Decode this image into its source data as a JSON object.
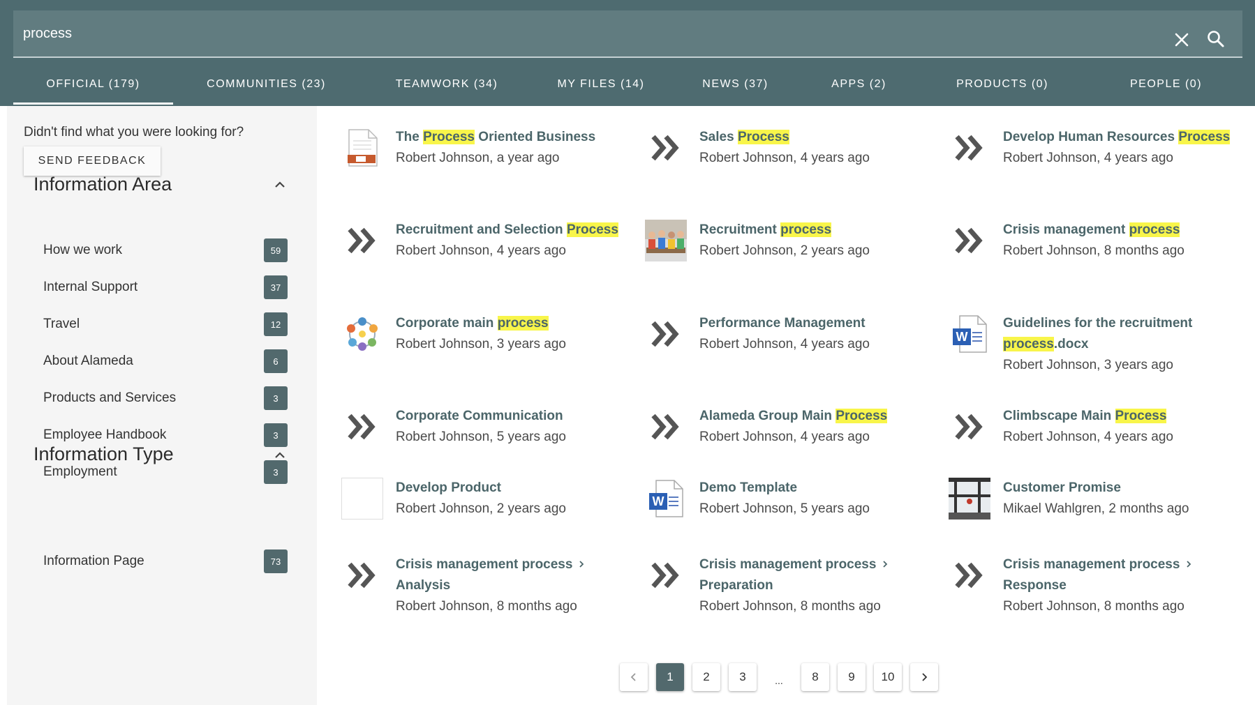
{
  "search": {
    "value": "process"
  },
  "tabs": [
    {
      "label": "OFFICIAL (179)",
      "active": true
    },
    {
      "label": "COMMUNITIES (23)",
      "active": false
    },
    {
      "label": "TEAMWORK (34)",
      "active": false
    },
    {
      "label": "MY FILES (14)",
      "active": false
    },
    {
      "label": "NEWS (37)",
      "active": false
    },
    {
      "label": "APPS (2)",
      "active": false
    },
    {
      "label": "PRODUCTS (0)",
      "active": false
    },
    {
      "label": "PEOPLE (0)",
      "active": false
    }
  ],
  "sidebar": {
    "feedback_text": "Didn't find what you were looking for?",
    "feedback_button": "SEND FEEDBACK",
    "information_area": {
      "title": "Information Area",
      "items": [
        {
          "label": "How we work",
          "count": "59"
        },
        {
          "label": "Internal Support",
          "count": "37"
        },
        {
          "label": "Travel",
          "count": "12"
        },
        {
          "label": "About Alameda",
          "count": "6"
        },
        {
          "label": "Products and Services",
          "count": "3"
        },
        {
          "label": "Employee Handbook",
          "count": "3"
        },
        {
          "label": "Employment",
          "count": "3"
        }
      ]
    },
    "information_type": {
      "title": "Information Type",
      "items": [
        {
          "label": "Information Page",
          "count": "73"
        }
      ]
    }
  },
  "results": [
    {
      "title": [
        "The ",
        "Process",
        " Oriented Business"
      ],
      "meta": "Robert Johnson, a year ago",
      "icon": "document-icon"
    },
    {
      "title": [
        "",
        "Sales ",
        "Process"
      ],
      "meta": "Robert Johnson, 4 years ago",
      "icon": "double-chevron-icon"
    },
    {
      "title": [
        "Develop Human Resources ",
        "Process",
        ""
      ],
      "meta": "Robert Johnson, 4 years ago",
      "icon": "double-chevron-icon"
    },
    {
      "title": [
        "Recruitment and Selection ",
        "Process",
        ""
      ],
      "meta": "Robert Johnson, 4 years ago",
      "icon": "double-chevron-icon"
    },
    {
      "title": [
        "Recruitment ",
        "process",
        ""
      ],
      "meta": "Robert Johnson, 2 years ago",
      "icon": "people-photo-icon"
    },
    {
      "title": [
        "Crisis management ",
        "process",
        ""
      ],
      "meta": "Robert Johnson, 8 months ago",
      "icon": "double-chevron-icon"
    },
    {
      "title": [
        "Corporate main ",
        "process",
        ""
      ],
      "meta": "Robert Johnson, 3 years ago",
      "icon": "process-diagram-icon"
    },
    {
      "title": [
        "Performance Management",
        "",
        ""
      ],
      "meta": "Robert Johnson, 4 years ago",
      "icon": "double-chevron-icon"
    },
    {
      "title": [
        "Guidelines for the recruitment ",
        "process",
        ".docx"
      ],
      "meta": "Robert Johnson, 3 years ago",
      "icon": "word-document-icon"
    },
    {
      "title": [
        "Corporate Communication",
        "",
        ""
      ],
      "meta": "Robert Johnson, 5 years ago",
      "icon": "double-chevron-icon"
    },
    {
      "title": [
        "Alameda Group Main ",
        "Process",
        ""
      ],
      "meta": "Robert Johnson, 4 years ago",
      "icon": "double-chevron-icon"
    },
    {
      "title": [
        "Climbscape Main ",
        "Process",
        ""
      ],
      "meta": "Robert Johnson, 4 years ago",
      "icon": "double-chevron-icon"
    },
    {
      "title": [
        "Develop Product",
        "",
        ""
      ],
      "meta": "Robert Johnson, 2 years ago",
      "icon": "blank-image-icon"
    },
    {
      "title": [
        "Demo Template",
        "",
        ""
      ],
      "meta": "Robert Johnson, 5 years ago",
      "icon": "word-document-icon"
    },
    {
      "title": [
        "Customer Promise",
        "",
        ""
      ],
      "meta": "Mikael Wahlgren, 2 months ago",
      "icon": "window-photo-icon"
    },
    {
      "crumb": "Crisis management process",
      "title": [
        "Analysis",
        "",
        ""
      ],
      "meta": "Robert Johnson, 8 months ago",
      "icon": "double-chevron-icon"
    },
    {
      "crumb": "Crisis management process",
      "title": [
        "Preparation",
        "",
        ""
      ],
      "meta": "Robert Johnson, 8 months ago",
      "icon": "double-chevron-icon"
    },
    {
      "crumb": "Crisis management process",
      "title": [
        "Response",
        "",
        ""
      ],
      "meta": "Robert Johnson, 8 months ago",
      "icon": "double-chevron-icon"
    }
  ],
  "pagination": {
    "pages": [
      "1",
      "2",
      "3",
      "...",
      "8",
      "9",
      "10"
    ],
    "current": "1"
  },
  "colors": {
    "header": "#4e6b70",
    "accent": "#52696d",
    "highlight": "#f8f54a",
    "title_text": "#4b6569"
  }
}
